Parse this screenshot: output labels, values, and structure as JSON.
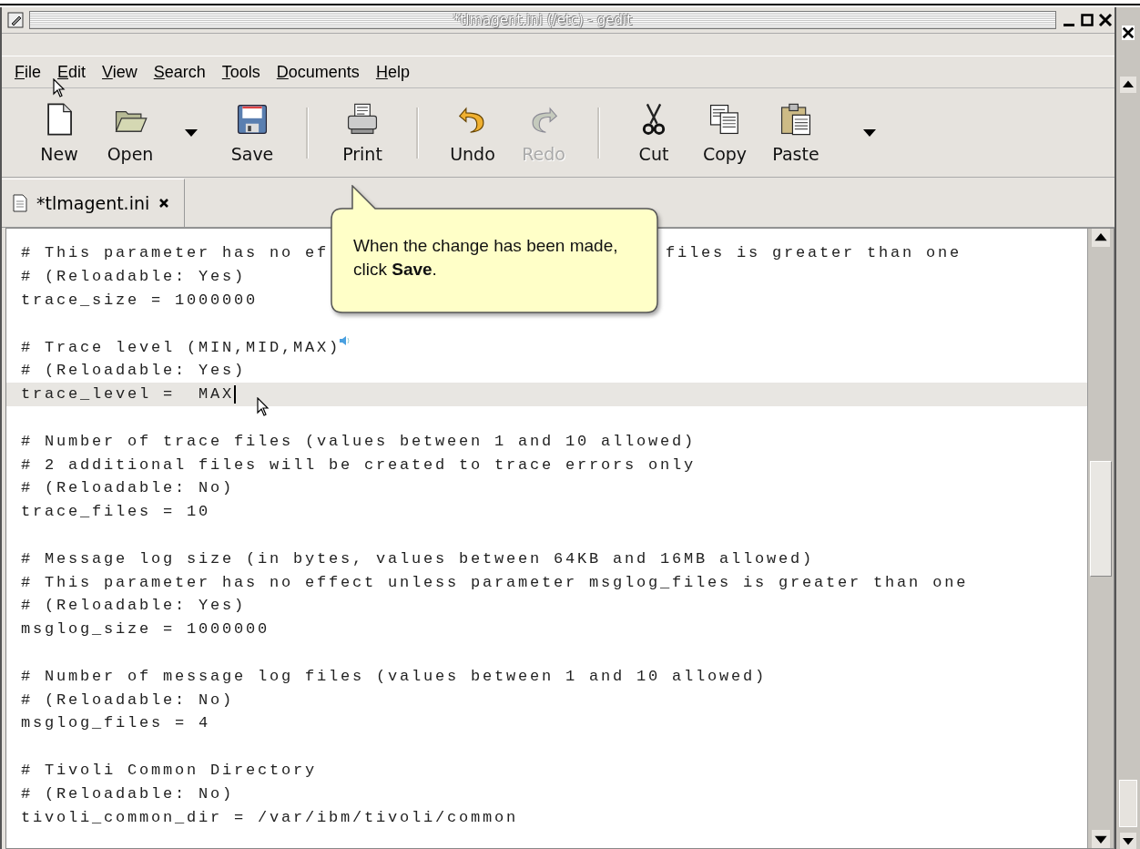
{
  "window": {
    "title": "*tlmagent.ini (/etc) - gedit"
  },
  "menu": [
    {
      "label": "File"
    },
    {
      "label": "Edit"
    },
    {
      "label": "View"
    },
    {
      "label": "Search"
    },
    {
      "label": "Tools"
    },
    {
      "label": "Documents"
    },
    {
      "label": "Help"
    }
  ],
  "toolbar": [
    {
      "kind": "button",
      "label": "New",
      "disabled": false
    },
    {
      "kind": "button",
      "label": "Open",
      "disabled": false
    },
    {
      "kind": "dropdown"
    },
    {
      "kind": "button",
      "label": "Save",
      "disabled": false
    },
    {
      "kind": "separator"
    },
    {
      "kind": "button",
      "label": "Print",
      "disabled": false
    },
    {
      "kind": "separator"
    },
    {
      "kind": "button",
      "label": "Undo",
      "disabled": false
    },
    {
      "kind": "button",
      "label": "Redo",
      "disabled": true
    },
    {
      "kind": "separator"
    },
    {
      "kind": "button",
      "label": "Cut",
      "disabled": false
    },
    {
      "kind": "button",
      "label": "Copy",
      "disabled": false
    },
    {
      "kind": "button",
      "label": "Paste",
      "disabled": false
    },
    {
      "kind": "overflow"
    }
  ],
  "tabs": [
    {
      "label": "*tlmagent.ini",
      "selected": true
    }
  ],
  "editor": {
    "lines": [
      {
        "kind": "text",
        "text": "# This parameter has no ef",
        "tail": "files is greater than one"
      },
      {
        "kind": "text",
        "text": "# (Reloadable: Yes)"
      },
      {
        "kind": "text",
        "text": "trace_size = 1000000"
      },
      {
        "kind": "blank"
      },
      {
        "kind": "text",
        "text": "# Trace level (MIN,MID,MAX)",
        "speaker": true
      },
      {
        "kind": "text",
        "text": "# (Reloadable: Yes)"
      },
      {
        "kind": "text",
        "text": "trace_level =  MAX",
        "current": true
      },
      {
        "kind": "blank"
      },
      {
        "kind": "text",
        "text": "# Number of trace files (values between 1 and 10 allowed)"
      },
      {
        "kind": "text",
        "text": "# 2 additional files will be created to trace errors only"
      },
      {
        "kind": "text",
        "text": "# (Reloadable: No)"
      },
      {
        "kind": "text",
        "text": "trace_files = 10"
      },
      {
        "kind": "blank"
      },
      {
        "kind": "text",
        "text": "# Message log size (in bytes, values between 64KB and 16MB allowed)"
      },
      {
        "kind": "text",
        "text": "# This parameter has no effect unless parameter msglog_files is greater than one"
      },
      {
        "kind": "text",
        "text": "# (Reloadable: Yes)"
      },
      {
        "kind": "text",
        "text": "msglog_size = 1000000"
      },
      {
        "kind": "blank"
      },
      {
        "kind": "text",
        "text": "# Number of message log files (values between 1 and 10 allowed)"
      },
      {
        "kind": "text",
        "text": "# (Reloadable: No)"
      },
      {
        "kind": "text",
        "text": "msglog_files = 4"
      },
      {
        "kind": "blank"
      },
      {
        "kind": "text",
        "text": "# Tivoli Common Directory"
      },
      {
        "kind": "text",
        "text": "# (Reloadable: No)"
      },
      {
        "kind": "text",
        "text": "tivoli_common_dir = /var/ibm/tivoli/common"
      }
    ]
  },
  "callout": {
    "text": "When the change has been made, click **Save**."
  }
}
